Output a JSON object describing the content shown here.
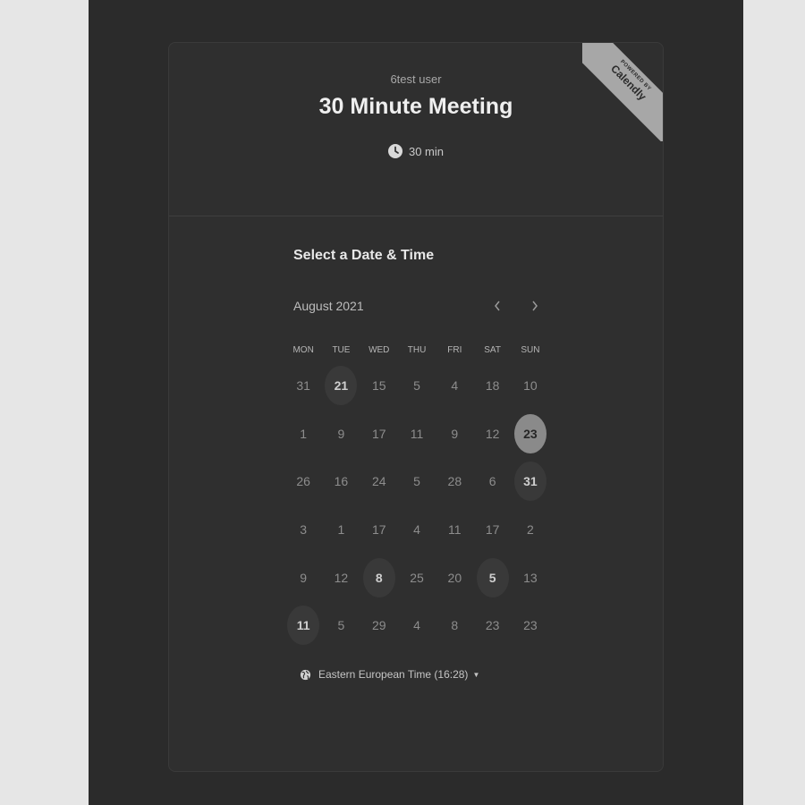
{
  "header": {
    "host_name": "6test user",
    "event_title": "30 Minute Meeting",
    "duration": "30 min",
    "ribbon_small": "POWERED BY",
    "ribbon_brand": "Calendly"
  },
  "scheduler": {
    "section_title": "Select a Date & Time",
    "month_label": "August 2021",
    "prev_icon": "chevron-left-icon",
    "next_icon": "chevron-right-icon",
    "weekdays": [
      "MON",
      "TUE",
      "WED",
      "THU",
      "FRI",
      "SAT",
      "SUN"
    ],
    "weeks": [
      [
        "31",
        "21",
        "15",
        "5",
        "4",
        "18",
        "10"
      ],
      [
        "1",
        "9",
        "17",
        "11",
        "9",
        "12",
        "23"
      ],
      [
        "26",
        "16",
        "24",
        "5",
        "28",
        "6",
        "31"
      ],
      [
        "3",
        "1",
        "17",
        "4",
        "11",
        "17",
        "2"
      ],
      [
        "9",
        "12",
        "8",
        "25",
        "20",
        "5",
        "13"
      ],
      [
        "11",
        "5",
        "29",
        "4",
        "8",
        "23",
        "23"
      ]
    ],
    "available_days": [
      "0-1",
      "1-6",
      "2-6",
      "4-2",
      "4-5",
      "5-0"
    ],
    "selected_day": "1-6",
    "timezone": "Eastern European Time (16:28)"
  },
  "colors": {
    "page_background": "#2b2b2b",
    "outer_background": "#e6e6e6",
    "card_background": "#2f2f2f",
    "selected_day": "#8a8a8a",
    "available_day": "#393939",
    "ribbon": "#a7a7a7"
  }
}
